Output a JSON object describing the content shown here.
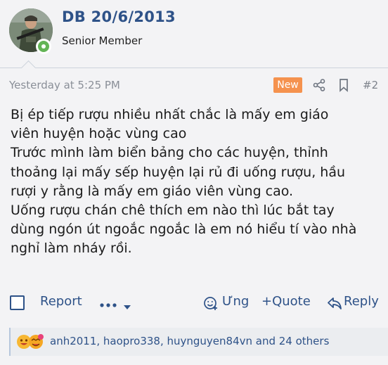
{
  "user": {
    "name": "DB 20/6/2013",
    "title": "Senior Member"
  },
  "post": {
    "time": "Yesterday at 5:25 PM",
    "badge": "New",
    "number": "#2",
    "lines": [
      "Bị ép tiếp rượu nhiều nhất chắc là mấy em giáo",
      "viên huyện hoặc vùng cao",
      "Trước mình làm biển bảng cho các huyện, thỉnh",
      "thoảng lại mấy sếp huyện lại rủ đi uống rượu, hầu",
      "rượi y rằng là mấy em giáo viên vùng cao.",
      "Uống rượu chán chê thích em nào thì lúc bắt tay",
      "dùng ngón út ngoắc ngoắc là em nó hiểu tí vào nhà",
      "nghỉ làm nháy rồi."
    ]
  },
  "actions": {
    "report": "Report",
    "react": "Ưng",
    "quote": "+Quote",
    "reply": "Reply"
  },
  "reactions": {
    "text": "anh2011, haopro338, huynguyen84vn and 24 others"
  },
  "colors": {
    "accent": "#2e5288",
    "badge": "#f5924e",
    "online": "#63b456"
  }
}
